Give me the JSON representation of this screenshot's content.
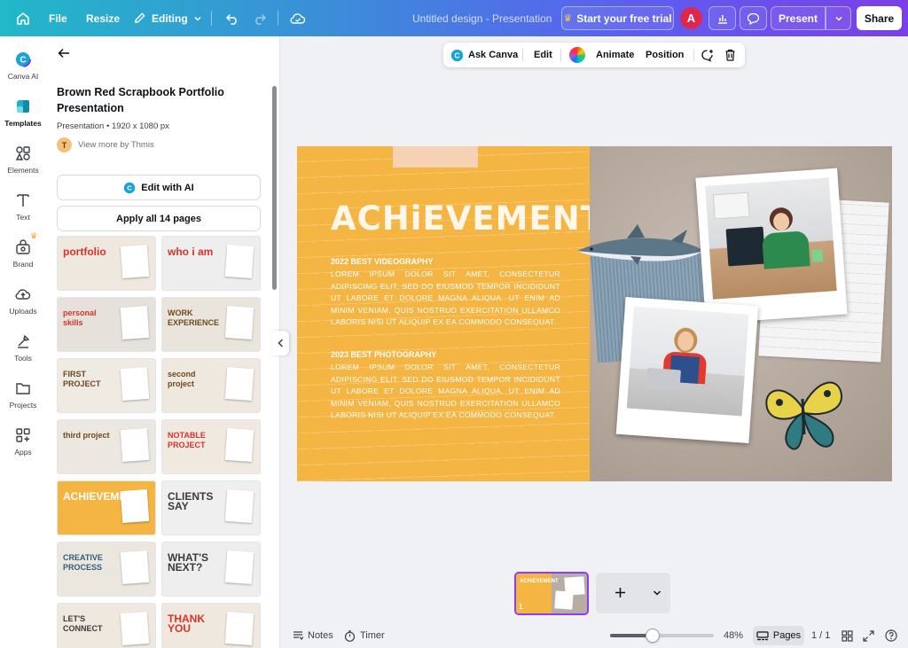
{
  "topbar": {
    "file": "File",
    "resize": "Resize",
    "editing": "Editing",
    "doc_title": "Untitled design - Presentation",
    "trial": "Start your free trial",
    "avatar": "A",
    "present": "Present",
    "share": "Share"
  },
  "rail": {
    "items": [
      {
        "label": "Canva AI",
        "icon": "canva-ai-icon"
      },
      {
        "label": "Templates",
        "icon": "templates-icon"
      },
      {
        "label": "Elements",
        "icon": "elements-icon"
      },
      {
        "label": "Text",
        "icon": "text-icon"
      },
      {
        "label": "Brand",
        "icon": "brand-icon"
      },
      {
        "label": "Uploads",
        "icon": "uploads-icon"
      },
      {
        "label": "Tools",
        "icon": "tools-icon"
      },
      {
        "label": "Projects",
        "icon": "projects-icon"
      },
      {
        "label": "Apps",
        "icon": "apps-icon"
      }
    ]
  },
  "panel": {
    "title": "Brown Red Scrapbook Portfolio Presentation",
    "subtitle": "Presentation • 1920 x 1080 px",
    "author_initial": "T",
    "author": "View more by Thmis",
    "edit_ai": "Edit with AI",
    "apply_all": "Apply all 14 pages",
    "thumbnails": [
      {
        "label": "portfolio",
        "bg": "#efe8de",
        "color": "#d6332a"
      },
      {
        "label": "who i am",
        "bg": "#eeeeee",
        "color": "#d6332a"
      },
      {
        "label": "personal skills",
        "bg": "#e6e1da",
        "color": "#d6332a"
      },
      {
        "label": "WORK EXPERIENCE",
        "bg": "#eae5dc",
        "color": "#6b4a22"
      },
      {
        "label": "FIRST PROJECT",
        "bg": "#f0ebe2",
        "color": "#6b4a22"
      },
      {
        "label": "second project",
        "bg": "#efe8de",
        "color": "#6b4a22"
      },
      {
        "label": "third project",
        "bg": "#ece8e1",
        "color": "#6b4a22"
      },
      {
        "label": "NOTABLE PROJECT",
        "bg": "#efe9e0",
        "color": "#d6332a"
      },
      {
        "label": "ACHIEVEMENT",
        "bg": "#f5b543",
        "color": "#ffffff"
      },
      {
        "label": "CLIENTS SAY",
        "bg": "#efefef",
        "color": "#3b3b3b"
      },
      {
        "label": "CREATIVE PROCESS",
        "bg": "#ece7de",
        "color": "#2f5d7c"
      },
      {
        "label": "WHAT'S NEXT?",
        "bg": "#eeeeee",
        "color": "#3b3b3b"
      },
      {
        "label": "LET'S CONNECT",
        "bg": "#efe8de",
        "color": "#3b3b3b"
      },
      {
        "label": "THANK YOU",
        "bg": "#efe8de",
        "color": "#d6332a"
      }
    ]
  },
  "context_toolbar": {
    "ask": "Ask Canva",
    "edit": "Edit",
    "animate": "Animate",
    "position": "Position"
  },
  "slide": {
    "title": "ACHiEVEMENT",
    "sections": [
      {
        "heading": "2022 BEST VIDEOGRAPHY",
        "body": "LOREM IPSUM DOLOR SIT AMET, CONSECTETUR ADIPISCING ELIT, SED DO EIUSMOD TEMPOR INCIDIDUNT UT LABORE ET DOLORE MAGNA ALIQUA. UT ENIM AD MINIM VENIAM, QUIS NOSTRUD EXERCITATION ULLAMCO LABORIS NISI UT ALIQUIP EX EA COMMODO CONSEQUAT."
      },
      {
        "heading": "2023 BEST PHOTOGRAPHY",
        "body": "LOREM IPSUM DOLOR SIT AMET, CONSECTETUR ADIPISCING ELIT, SED DO EIUSMOD TEMPOR INCIDIDUNT UT LABORE ET DOLORE MAGNA ALIQUA. UT ENIM AD MINIM VENIAM, QUIS NOSTRUD EXERCITATION ULLAMCO LABORIS NISI UT ALIQUIP EX EA COMMODO CONSEQUAT."
      }
    ]
  },
  "page_strip": {
    "page_number": "1",
    "thumb_label": "ACHiEVEMENT"
  },
  "bottom": {
    "notes": "Notes",
    "timer": "Timer",
    "zoom": "48%",
    "zoom_level": 0.41,
    "pages": "Pages",
    "page_count": "1 / 1"
  },
  "colors": {
    "accent": "#8b3dff",
    "slide_orange": "#f5b543",
    "brand_red": "#e0264f"
  }
}
